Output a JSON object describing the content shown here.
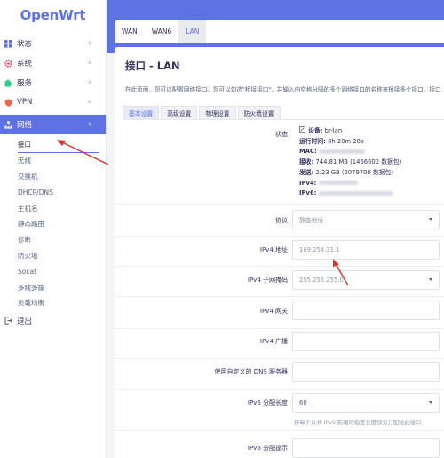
{
  "brand": "OpenWrt",
  "sidebar": {
    "items": [
      {
        "label": "状态",
        "icon": "grid-icon",
        "chevron": true
      },
      {
        "label": "系统",
        "icon": "gear-icon",
        "chevron": true
      },
      {
        "label": "服务",
        "icon": "puzzle-icon",
        "chevron": true
      },
      {
        "label": "VPN",
        "icon": "shield-icon",
        "chevron": true
      },
      {
        "label": "网络",
        "icon": "network-icon",
        "chevron": true,
        "active": true
      }
    ],
    "network_submenu": [
      "接口",
      "无线",
      "交换机",
      "DHCP/DNS",
      "主机名",
      "静态路由",
      "诊断",
      "防火墙",
      "Socat",
      "多线多拨",
      "负载均衡"
    ],
    "logout": {
      "label": "退出",
      "icon": "logout-icon"
    },
    "accent": "#5e72e4"
  },
  "tabs": [
    "WAN",
    "WAN6",
    "LAN"
  ],
  "active_tab": "LAN",
  "main": {
    "title": "接口 - LAN",
    "description": "在此页面，您可以配置网络接口。您可以勾选\"桥接接口\"，并输入由空格分隔的多个网络接口的名称来桥接多个接口。接口...",
    "subtabs": [
      "基本设置",
      "高级设置",
      "物理设置",
      "防火墙设置"
    ],
    "active_subtab": "基本设置",
    "status": {
      "label": "状态",
      "device_label": "设备:",
      "device": "br-lan",
      "uptime_label": "运行时间:",
      "uptime": "8h 20m 20s",
      "mac_label": "MAC:",
      "rx_label": "接收:",
      "rx": "744.81 MB (1466602 数据包)",
      "tx_label": "发送:",
      "tx": "2.23 GB (2079700 数据包)",
      "ipv4_label": "IPv4:",
      "ipv6_label": "IPv6:"
    },
    "fields": {
      "protocol": {
        "label": "协议",
        "value": "静态地址"
      },
      "ipv4_addr": {
        "label": "IPv4 地址",
        "value": "169.254.31.1"
      },
      "ipv4_mask": {
        "label": "IPv4 子网掩码",
        "value": "255.255.255.0"
      },
      "ipv4_gw": {
        "label": "IPv4 网关",
        "value": ""
      },
      "ipv4_bcast": {
        "label": "IPv4 广播",
        "value": ""
      },
      "dns": {
        "label": "使用自定义的 DNS 服务器",
        "value": ""
      },
      "ipv6_len": {
        "label": "IPv6 分配长度",
        "value": "60",
        "hint": "将每个公共 IPv6 前缀的指定长度部分分配给此接口"
      },
      "ipv6_hint": {
        "label": "IPv6 分配提示",
        "value": ""
      }
    }
  },
  "annotation_color": "#d9342b"
}
